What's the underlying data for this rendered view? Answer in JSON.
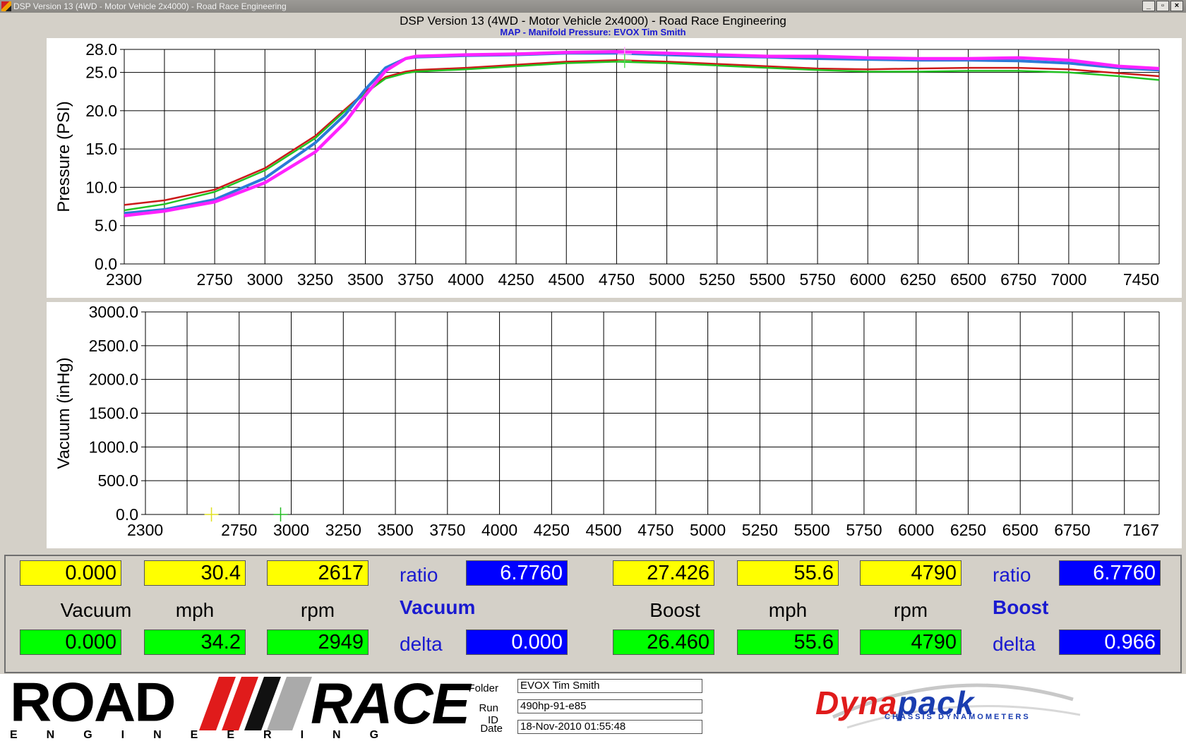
{
  "window": {
    "title": "DSP Version 13 (4WD - Motor Vehicle 2x4000) - Road Race Engineering",
    "buttons": [
      "_",
      "▫",
      "×"
    ]
  },
  "header": {
    "title": "DSP Version 13 (4WD - Motor Vehicle 2x4000) - Road Race Engineering",
    "subtitle": "MAP - Manifold Pressure: EVOX Tim Smith"
  },
  "chart_data": [
    {
      "type": "line",
      "ylabel": "Pressure (PSI)",
      "xlim": [
        2300,
        7450
      ],
      "ylim": [
        0,
        28
      ],
      "yticks": [
        {
          "v": 0,
          "label": "0.0"
        },
        {
          "v": 5,
          "label": "5.0"
        },
        {
          "v": 10,
          "label": "10.0"
        },
        {
          "v": 15,
          "label": "15.0"
        },
        {
          "v": 20,
          "label": "20.0"
        },
        {
          "v": 25,
          "label": "25.0"
        },
        {
          "v": 28,
          "label": "28.0"
        }
      ],
      "xticks": [
        {
          "v": 2300,
          "label": "2300"
        },
        {
          "v": 2750,
          "label": "2750"
        },
        {
          "v": 3000,
          "label": "3000"
        },
        {
          "v": 3250,
          "label": "3250"
        },
        {
          "v": 3500,
          "label": "3500"
        },
        {
          "v": 3750,
          "label": "3750"
        },
        {
          "v": 4000,
          "label": "4000"
        },
        {
          "v": 4250,
          "label": "4250"
        },
        {
          "v": 4500,
          "label": "4500"
        },
        {
          "v": 4750,
          "label": "4750"
        },
        {
          "v": 5000,
          "label": "5000"
        },
        {
          "v": 5250,
          "label": "5250"
        },
        {
          "v": 5500,
          "label": "5500"
        },
        {
          "v": 5750,
          "label": "5750"
        },
        {
          "v": 6000,
          "label": "6000"
        },
        {
          "v": 6250,
          "label": "6250"
        },
        {
          "v": 6500,
          "label": "6500"
        },
        {
          "v": 6750,
          "label": "6750"
        },
        {
          "v": 7000,
          "label": "7000"
        },
        {
          "v": 7450,
          "label": "7450"
        }
      ],
      "extra_gridlines_x": [
        2500,
        7250
      ],
      "grid": true,
      "series": [
        {
          "color": "#cc1a1a",
          "width": 2.5,
          "points": [
            [
              2300,
              7.7
            ],
            [
              2500,
              8.3
            ],
            [
              2750,
              9.7
            ],
            [
              3000,
              12.5
            ],
            [
              3250,
              16.7
            ],
            [
              3400,
              20.2
            ],
            [
              3500,
              22.5
            ],
            [
              3600,
              24.4
            ],
            [
              3700,
              25.1
            ],
            [
              3750,
              25.3
            ],
            [
              4000,
              25.6
            ],
            [
              4250,
              26.0
            ],
            [
              4500,
              26.4
            ],
            [
              4750,
              26.6
            ],
            [
              5000,
              26.4
            ],
            [
              5250,
              26.1
            ],
            [
              5500,
              25.8
            ],
            [
              5750,
              25.5
            ],
            [
              6000,
              25.4
            ],
            [
              6250,
              25.5
            ],
            [
              6500,
              25.6
            ],
            [
              6750,
              25.6
            ],
            [
              7000,
              25.4
            ],
            [
              7250,
              24.9
            ],
            [
              7450,
              24.5
            ]
          ]
        },
        {
          "color": "#22c322",
          "width": 2.5,
          "points": [
            [
              2300,
              7.0
            ],
            [
              2500,
              7.8
            ],
            [
              2750,
              9.4
            ],
            [
              3000,
              12.2
            ],
            [
              3250,
              16.4
            ],
            [
              3400,
              20.0
            ],
            [
              3500,
              22.3
            ],
            [
              3600,
              24.2
            ],
            [
              3700,
              24.9
            ],
            [
              3750,
              25.1
            ],
            [
              4000,
              25.4
            ],
            [
              4250,
              25.8
            ],
            [
              4500,
              26.2
            ],
            [
              4750,
              26.4
            ],
            [
              5000,
              26.2
            ],
            [
              5250,
              25.9
            ],
            [
              5500,
              25.6
            ],
            [
              5750,
              25.3
            ],
            [
              6000,
              25.1
            ],
            [
              6250,
              25.1
            ],
            [
              6500,
              25.2
            ],
            [
              6750,
              25.2
            ],
            [
              7000,
              25.0
            ],
            [
              7250,
              24.5
            ],
            [
              7450,
              24.0
            ]
          ]
        },
        {
          "color": "#2a7ad8",
          "width": 4,
          "points": [
            [
              2300,
              6.6
            ],
            [
              2500,
              7.1
            ],
            [
              2750,
              8.4
            ],
            [
              3000,
              11.2
            ],
            [
              3250,
              15.8
            ],
            [
              3400,
              19.5
            ],
            [
              3500,
              22.8
            ],
            [
              3600,
              25.6
            ],
            [
              3700,
              26.8
            ],
            [
              3750,
              27.0
            ],
            [
              4000,
              27.2
            ],
            [
              4250,
              27.3
            ],
            [
              4500,
              27.5
            ],
            [
              4750,
              27.5
            ],
            [
              5000,
              27.3
            ],
            [
              5250,
              27.1
            ],
            [
              5500,
              27.0
            ],
            [
              5750,
              26.8
            ],
            [
              6000,
              26.7
            ],
            [
              6250,
              26.6
            ],
            [
              6500,
              26.6
            ],
            [
              6750,
              26.5
            ],
            [
              7000,
              26.2
            ],
            [
              7250,
              25.6
            ],
            [
              7450,
              25.3
            ]
          ]
        },
        {
          "color": "#ff22ff",
          "width": 4.5,
          "points": [
            [
              2300,
              6.3
            ],
            [
              2500,
              6.9
            ],
            [
              2750,
              8.1
            ],
            [
              3000,
              10.6
            ],
            [
              3250,
              14.6
            ],
            [
              3400,
              18.5
            ],
            [
              3500,
              22.0
            ],
            [
              3600,
              25.2
            ],
            [
              3700,
              26.8
            ],
            [
              3750,
              27.1
            ],
            [
              4000,
              27.3
            ],
            [
              4250,
              27.4
            ],
            [
              4500,
              27.6
            ],
            [
              4750,
              27.7
            ],
            [
              5000,
              27.5
            ],
            [
              5250,
              27.3
            ],
            [
              5500,
              27.1
            ],
            [
              5750,
              27.1
            ],
            [
              6000,
              26.9
            ],
            [
              6250,
              26.8
            ],
            [
              6500,
              26.8
            ],
            [
              6750,
              26.9
            ],
            [
              7000,
              26.6
            ],
            [
              7250,
              25.8
            ],
            [
              7450,
              25.5
            ]
          ]
        }
      ],
      "cursors": [
        {
          "x": 4790,
          "y": 27.4,
          "color": "#ffaaff"
        },
        {
          "x": 4790,
          "y": 26.5,
          "color": "#55dd55"
        }
      ]
    },
    {
      "type": "line",
      "ylabel": "Vacuum (inHg)",
      "xlim": [
        2300,
        7167
      ],
      "ylim": [
        0,
        3000
      ],
      "yticks": [
        {
          "v": 0,
          "label": "0.0"
        },
        {
          "v": 500,
          "label": "500.0"
        },
        {
          "v": 1000,
          "label": "1000.0"
        },
        {
          "v": 1500,
          "label": "1500.0"
        },
        {
          "v": 2000,
          "label": "2000.0"
        },
        {
          "v": 2500,
          "label": "2500.0"
        },
        {
          "v": 3000,
          "label": "3000.0"
        }
      ],
      "xticks": [
        {
          "v": 2300,
          "label": "2300"
        },
        {
          "v": 2750,
          "label": "2750"
        },
        {
          "v": 3000,
          "label": "3000"
        },
        {
          "v": 3250,
          "label": "3250"
        },
        {
          "v": 3500,
          "label": "3500"
        },
        {
          "v": 3750,
          "label": "3750"
        },
        {
          "v": 4000,
          "label": "4000"
        },
        {
          "v": 4250,
          "label": "4250"
        },
        {
          "v": 4500,
          "label": "4500"
        },
        {
          "v": 4750,
          "label": "4750"
        },
        {
          "v": 5000,
          "label": "5000"
        },
        {
          "v": 5250,
          "label": "5250"
        },
        {
          "v": 5500,
          "label": "5500"
        },
        {
          "v": 5750,
          "label": "5750"
        },
        {
          "v": 6000,
          "label": "6000"
        },
        {
          "v": 6250,
          "label": "6250"
        },
        {
          "v": 6500,
          "label": "6500"
        },
        {
          "v": 6750,
          "label": "6750"
        },
        {
          "v": 7167,
          "label": "7167"
        }
      ],
      "extra_gridlines_x": [
        2500,
        7000
      ],
      "grid": true,
      "series": [],
      "cursors": [
        {
          "x": 2617,
          "y": 0,
          "color": "#e0e020"
        },
        {
          "x": 2949,
          "y": 0,
          "color": "#22bb22"
        }
      ]
    }
  ],
  "readouts": {
    "left": {
      "top": [
        "0.000",
        "30.4",
        "2617"
      ],
      "labels": [
        "Vacuum",
        "mph",
        "rpm"
      ],
      "bottom": [
        "0.000",
        "34.2",
        "2949"
      ],
      "ratio_label": "ratio",
      "ratio": "6.7760",
      "mode": "Vacuum",
      "delta_label": "delta",
      "delta": "0.000"
    },
    "right": {
      "top": [
        "27.426",
        "55.6",
        "4790"
      ],
      "labels": [
        "Boost",
        "mph",
        "rpm"
      ],
      "bottom": [
        "26.460",
        "55.6",
        "4790"
      ],
      "ratio_label": "ratio",
      "ratio": "6.7760",
      "mode": "Boost",
      "delta_label": "delta",
      "delta": "0.966"
    }
  },
  "footer": {
    "folder_label": "Folder",
    "folder": "EVOX Tim Smith",
    "runid_label": "Run ID",
    "runid": "490hp-91-e85",
    "date_label": "Date",
    "date": "18-Nov-2010 01:55:48",
    "logo_left": {
      "road": "ROAD",
      "race": "RACE",
      "engineering": "ENGINEERING"
    },
    "logo_right": {
      "dyna": "Dyna",
      "pack": "pack",
      "tagline": "CHASSIS DYNAMOMETERS"
    }
  }
}
